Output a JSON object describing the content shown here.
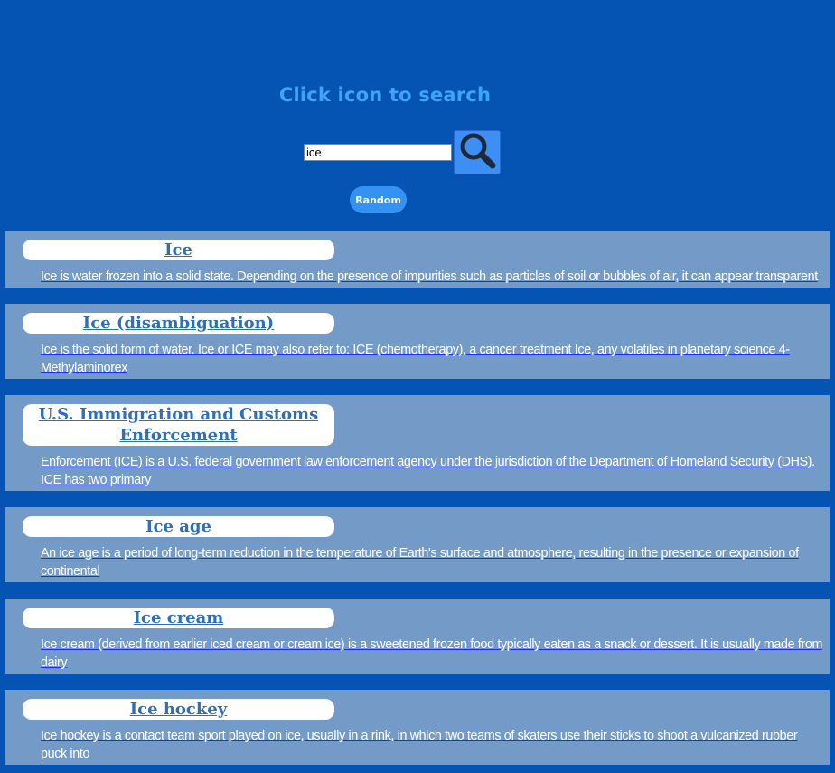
{
  "header": {
    "title": "Click icon to search"
  },
  "search": {
    "value": "ice",
    "icon": "magnifier-icon"
  },
  "random_label": "Random",
  "results": [
    {
      "title": "Ice",
      "snippet": "Ice is water frozen into a solid state. Depending on the presence of impurities such as particles of soil or bubbles of air, it can appear transparent"
    },
    {
      "title": "Ice (disambiguation)",
      "snippet": "Ice is the solid form of water. Ice or ICE may also refer to: ICE (chemotherapy), a cancer treatment Ice, any volatiles in planetary science 4-Methylaminorex"
    },
    {
      "title": "U.S. Immigration and Customs Enforcement",
      "snippet": "Enforcement (ICE) is a U.S. federal government law enforcement agency under the jurisdiction of the Department of Homeland Security (DHS). ICE has two primary"
    },
    {
      "title": "Ice age",
      "snippet": "An ice age is a period of long-term reduction in the temperature of Earth's surface and atmosphere, resulting in the presence or expansion of continental"
    },
    {
      "title": "Ice cream",
      "snippet": "Ice cream (derived from earlier iced cream or cream ice) is a sweetened frozen food typically eaten as a snack or dessert. It is usually made from dairy"
    },
    {
      "title": "Ice hockey",
      "snippet": "Ice hockey is a contact team sport played on ice, usually in a rink, in which two teams of skaters use their sticks to shoot a vulcanized rubber puck into"
    }
  ],
  "colors": {
    "background": "#0554b3",
    "heading": "#3fa4f7",
    "button": "#3592f5",
    "result_bg": "#749bc8",
    "title_link": "#2d6fb8"
  }
}
